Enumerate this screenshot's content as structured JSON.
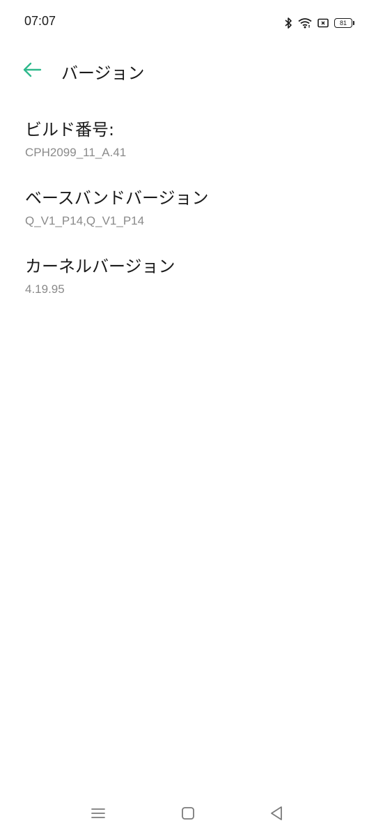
{
  "status_bar": {
    "time": "07:07",
    "battery_level": "81",
    "icons": [
      "bluetooth-icon",
      "wifi-icon",
      "sim-icon",
      "battery-icon"
    ]
  },
  "header": {
    "title": "バージョン",
    "back_icon": "back-arrow-icon",
    "accent_color": "#2fb98c"
  },
  "items": [
    {
      "title": "ビルド番号:",
      "value": "CPH2099_11_A.41"
    },
    {
      "title": "ベースバンドバージョン",
      "value": "Q_V1_P14,Q_V1_P14"
    },
    {
      "title": "カーネルバージョン",
      "value": "4.19.95"
    }
  ],
  "nav_bar": {
    "buttons": [
      "menu-icon",
      "home-icon",
      "back-icon"
    ]
  }
}
